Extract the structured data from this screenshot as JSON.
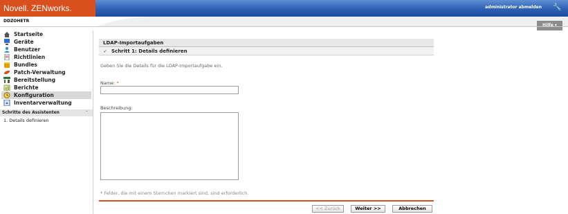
{
  "header": {
    "logo": "Novell. ZENworks.",
    "admin_link": "administrator abmelden",
    "wrench_icon": "wrench-icon"
  },
  "subbar": {
    "zone_name": "DDZOHETR",
    "help_label": "Hilfe ▾"
  },
  "sidebar": {
    "items": [
      {
        "label": "Startseite",
        "icon": "home-icon",
        "color": "#555555"
      },
      {
        "label": "Geräte",
        "icon": "device-icon",
        "color": "#2f6fc7"
      },
      {
        "label": "Benutzer",
        "icon": "user-icon",
        "color": "#3a8fd6"
      },
      {
        "label": "Richtlinien",
        "icon": "policy-icon",
        "color": "#7a7a7a"
      },
      {
        "label": "Bundles",
        "icon": "bundle-icon",
        "color": "#e0a000"
      },
      {
        "label": "Patch-Verwaltung",
        "icon": "patch-icon",
        "color": "#d9501f"
      },
      {
        "label": "Bereitstellung",
        "icon": "deploy-icon",
        "color": "#2a7a2a"
      },
      {
        "label": "Berichte",
        "icon": "report-icon",
        "color": "#8fa040"
      },
      {
        "label": "Konfiguration",
        "icon": "config-icon",
        "color": "#c9a300",
        "active": true
      },
      {
        "label": "Inventarverwaltung",
        "icon": "inventory-icon",
        "color": "#3a6fb0"
      }
    ],
    "wizard_heading": "Schritte des Assistenten",
    "wizard_steps": [
      "1. Details definieren"
    ]
  },
  "main": {
    "panel_title": "LDAP-Importaufgaben",
    "step_title": "Schritt 1: Details definieren",
    "intro": "Geben Sie die Details für die LDAP-Importaufgabe ein.",
    "name_label": "Name: ",
    "required_mark": "*",
    "name_value": "",
    "description_label": "Beschreibung:",
    "description_value": "",
    "footnote": "* Felder, die mit einem Sternchen markiert sind, sind erforderlich.",
    "buttons": {
      "back": "<< Zurück",
      "next": "Weiter >>",
      "cancel": "Abbrechen"
    }
  },
  "colors": {
    "brand_orange": "#d9501f",
    "header_blue": "#2d5fb3",
    "help_grey": "#8c8c8c"
  }
}
